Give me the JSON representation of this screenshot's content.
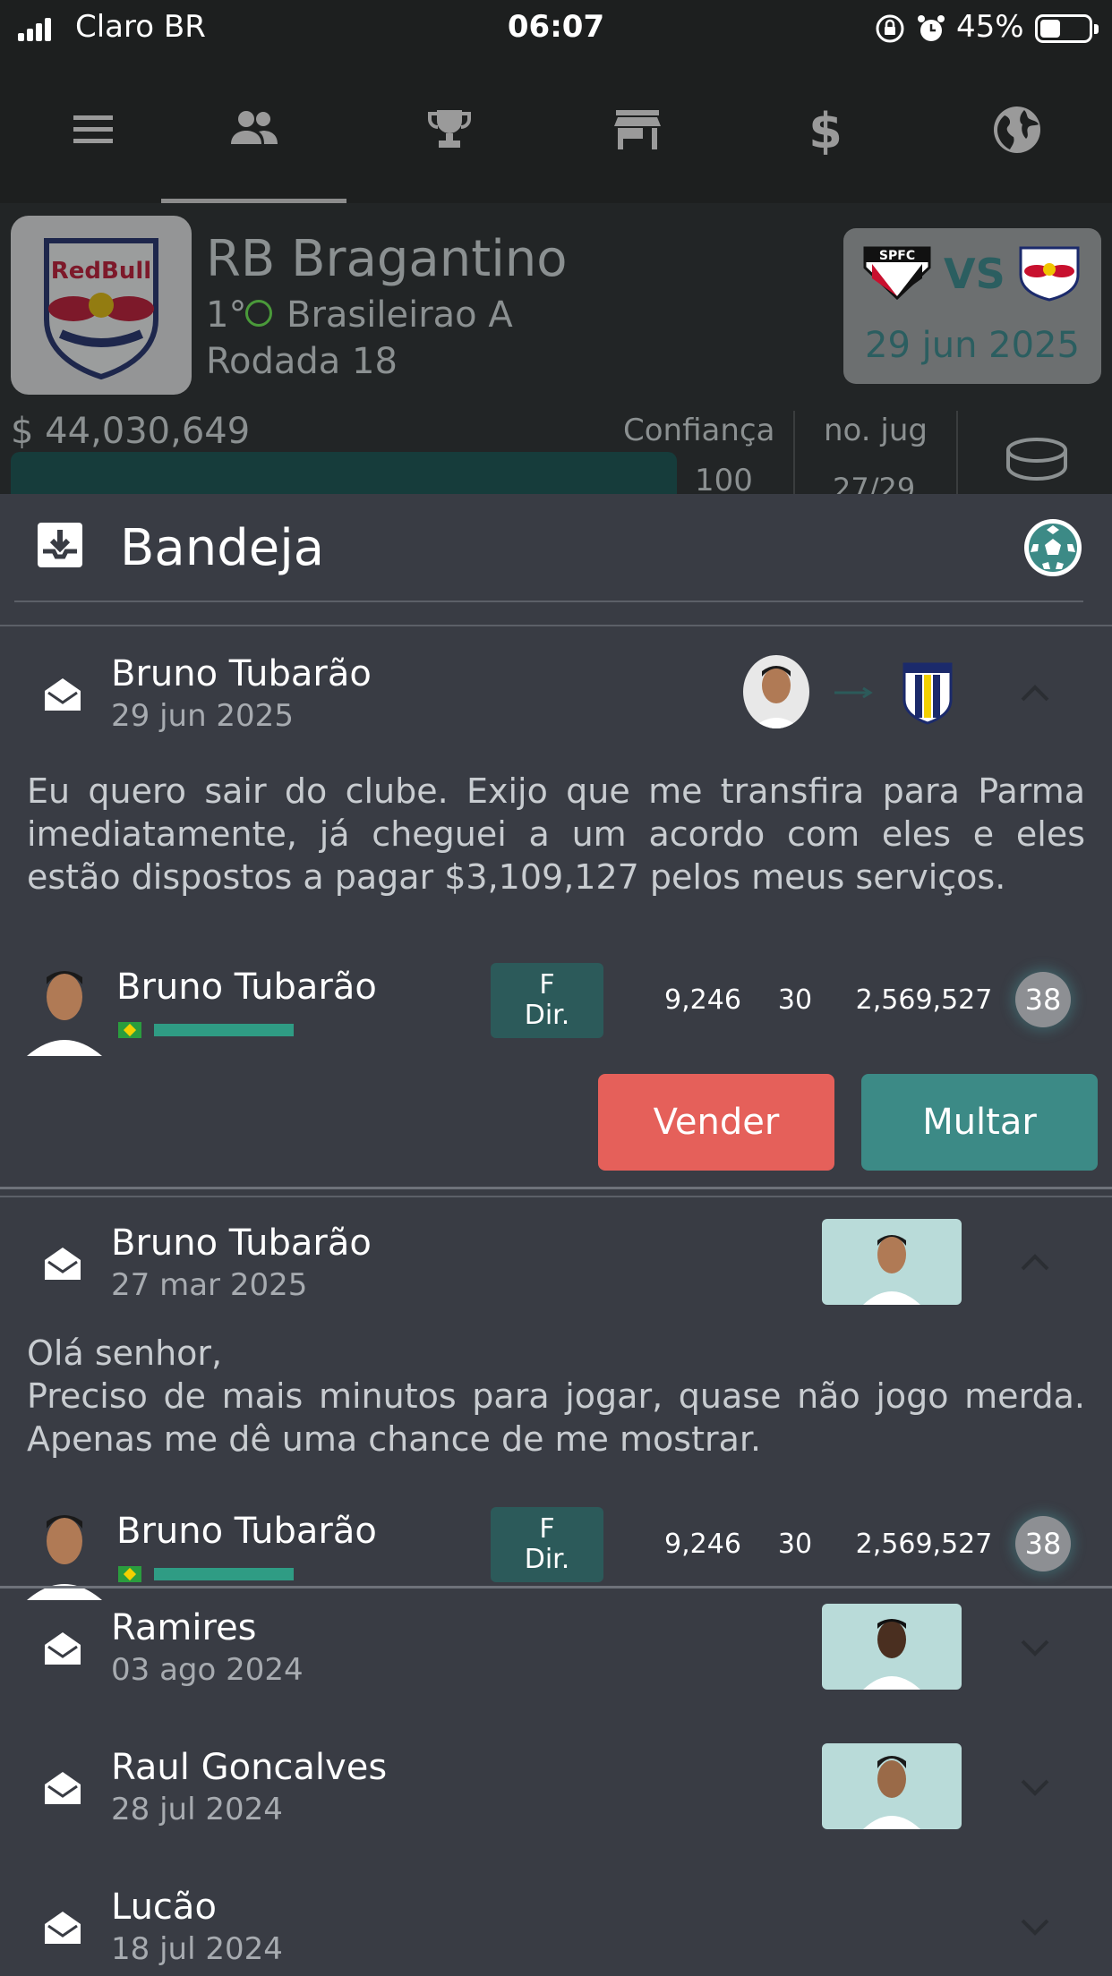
{
  "status_bar": {
    "carrier": "Claro BR",
    "time": "06:07",
    "battery": "45%",
    "battery_level": 0.45
  },
  "top_nav": {
    "items": [
      {
        "icon": "menu-icon",
        "active": false
      },
      {
        "icon": "people-icon",
        "active": true
      },
      {
        "icon": "trophy-icon",
        "active": false
      },
      {
        "icon": "store-icon",
        "active": false
      },
      {
        "icon": "dollar-icon",
        "active": false
      },
      {
        "icon": "globe-icon",
        "active": false
      }
    ]
  },
  "club": {
    "name": "RB Bragantino",
    "rank": "1°",
    "league": "Brasileirao A",
    "round": "Rodada 18",
    "money": "$ 44,030,649",
    "confidence_label": "Confiança",
    "confidence_value": "100",
    "players_label": "no. jug",
    "players_value": "27/29",
    "next_match": {
      "home_crest": "SPFC",
      "vs": "VS",
      "date": "29 jun 2025"
    }
  },
  "inbox": {
    "title": "Bandeja",
    "messages": [
      {
        "from": "Bruno Tubarão",
        "date": "29 jun 2025",
        "expanded": true,
        "body": "Eu quero sair do clube. Exijo que me transfira para Parma imediatamente, já cheguei a um acordo com eles e eles estão dispostos a pagar $3,109,127 pelos meus serviços.",
        "player": {
          "name": "Bruno Tubarão",
          "position_line1": "F",
          "position_line2": "Dir.",
          "stat1": "9,246",
          "stat2": "30",
          "value": "2,569,527",
          "rating": "38"
        },
        "actions": {
          "sell": "Vender",
          "fine": "Multar"
        }
      },
      {
        "from": "Bruno Tubarão",
        "date": "27 mar 2025",
        "expanded": true,
        "body": "Olá senhor,\nPreciso de mais minutos para jogar, quase não jogo merda. Apenas me dê uma chance de me mostrar.",
        "player": {
          "name": "Bruno Tubarão",
          "position_line1": "F",
          "position_line2": "Dir.",
          "stat1": "9,246",
          "stat2": "30",
          "value": "2,569,527",
          "rating": "38"
        }
      },
      {
        "from": "Ramires",
        "date": "03 ago 2024",
        "expanded": false
      },
      {
        "from": "Raul Goncalves",
        "date": "28 jul 2024",
        "expanded": false
      },
      {
        "from": "Lucão",
        "date": "18 jul 2024",
        "expanded": false
      }
    ]
  },
  "colors": {
    "background": "#1d1f1f",
    "sheet": "#393c44",
    "sell_button": "#e5605a",
    "fine_button": "#3c8a86",
    "position_badge": "#2c5a5a",
    "skill_bar": "#2f9c84"
  }
}
